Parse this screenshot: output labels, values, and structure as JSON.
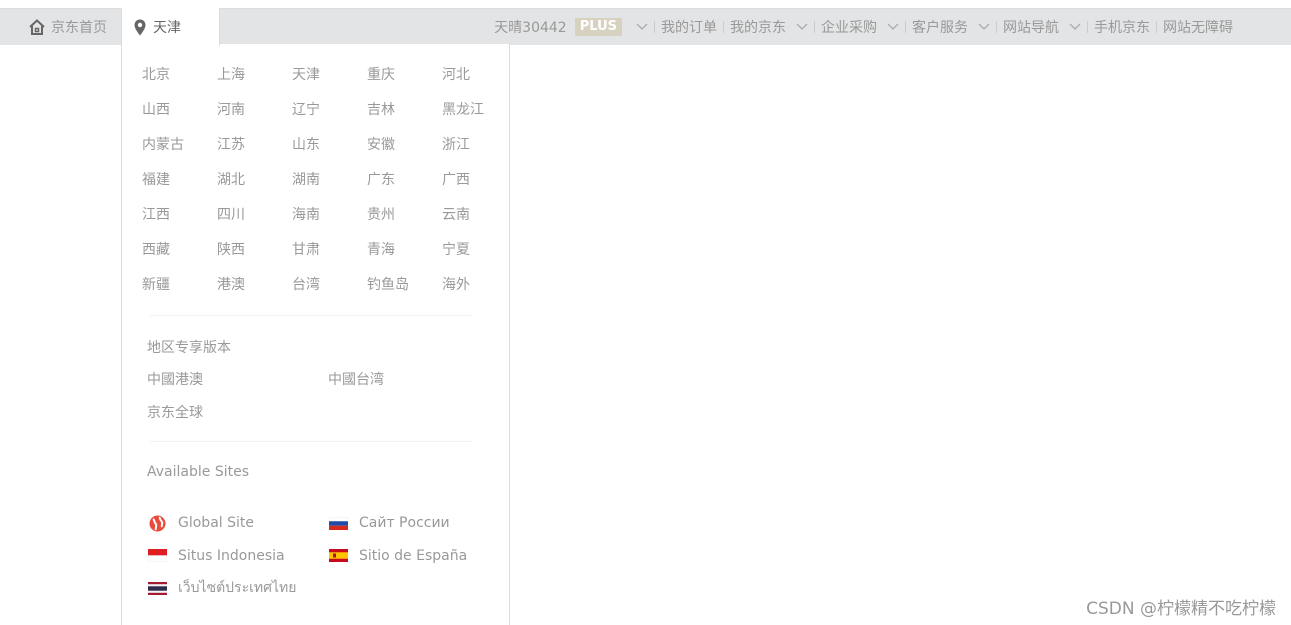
{
  "topbar": {
    "home_label": "京东首页",
    "location_label": "天津",
    "user_label": "天晴30442",
    "plus_badge": "PLUS",
    "nav": {
      "orders": "我的订单",
      "my_jd": "我的京东",
      "enterprise": "企业采购",
      "service": "客户服务",
      "site_nav": "网站导航",
      "mobile": "手机京东",
      "accessible": "网站无障碍"
    }
  },
  "location_panel": {
    "provinces": [
      "北京",
      "上海",
      "天津",
      "重庆",
      "河北",
      "山西",
      "河南",
      "辽宁",
      "吉林",
      "黑龙江",
      "内蒙古",
      "江苏",
      "山东",
      "安徽",
      "浙江",
      "福建",
      "湖北",
      "湖南",
      "广东",
      "广西",
      "江西",
      "四川",
      "海南",
      "贵州",
      "云南",
      "西藏",
      "陕西",
      "甘肃",
      "青海",
      "宁夏",
      "新疆",
      "港澳",
      "台湾",
      "钓鱼岛",
      "海外"
    ],
    "regional_title": "地区专享版本",
    "regional": [
      "中國港澳",
      "中國台湾",
      "京东全球"
    ],
    "available_title": "Available Sites",
    "sites": [
      {
        "label": "Global Site",
        "icon": "globe-icon"
      },
      {
        "label": "Сайт России",
        "icon": "russia-flag-icon"
      },
      {
        "label": "Situs Indonesia",
        "icon": "indonesia-flag-icon"
      },
      {
        "label": "Sitio de España",
        "icon": "spain-flag-icon"
      },
      {
        "label": "เว็บไซต์ประเทศไทย",
        "icon": "thailand-flag-icon"
      }
    ]
  },
  "watermark": "CSDN @柠檬精不吃柠檬"
}
